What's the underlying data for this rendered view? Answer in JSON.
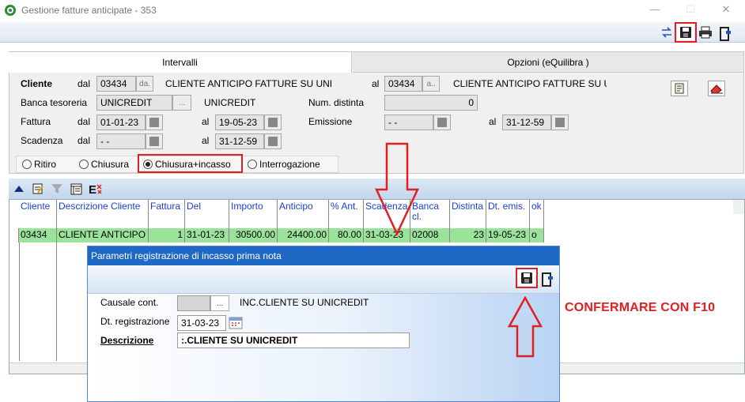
{
  "window": {
    "title": "Gestione fatture anticipate - 353",
    "minimize_glyph": "—",
    "maximize_glyph": "☐",
    "close_glyph": "✕"
  },
  "toolbar": {
    "icons": [
      "swap-arrows-icon",
      "save-icon",
      "print-icon",
      "exit-icon"
    ]
  },
  "tabs": [
    {
      "label": "Intervalli",
      "active": true
    },
    {
      "label": "Opzioni (eQuilibra )",
      "active": false
    }
  ],
  "filters": {
    "cliente": {
      "label": "Cliente",
      "dal_label": "dal",
      "al_label": "al",
      "from_code": "03434",
      "from_btn": "da.",
      "from_name": "CLIENTE ANTICIPO FATTURE SU UNI",
      "to_code": "03434",
      "to_btn": "a..",
      "to_name": "CLIENTE ANTICIPO FATTURE SU U"
    },
    "banca": {
      "label": "Banca tesoreria",
      "code": "UNICREDIT",
      "btn": "...",
      "name": "UNICREDIT",
      "num_distinta_label": "Num. distinta",
      "num_distinta": "0"
    },
    "fattura": {
      "label": "Fattura",
      "dal_label": "dal",
      "al_label": "al",
      "from": "01-01-23",
      "to": "19-05-23"
    },
    "emissione": {
      "label": "Emissione",
      "al_label": "al",
      "from": "- -",
      "to": "31-12-59"
    },
    "scadenza": {
      "label": "Scadenza",
      "dal_label": "dal",
      "al_label": "al",
      "from": "- -",
      "to": "31-12-59"
    }
  },
  "radio_options": [
    {
      "label": "Ritiro",
      "selected": false
    },
    {
      "label": "Chiusura",
      "selected": false
    },
    {
      "label": "Chiusura+incasso",
      "selected": true
    },
    {
      "label": "Interrogazione",
      "selected": false
    }
  ],
  "grid": {
    "columns": [
      "Cliente",
      "Descrizione Cliente",
      "Fattura",
      "Del",
      "Importo",
      "Anticipo",
      "% Ant.",
      "Scadenza",
      "Banca cl.",
      "Distinta",
      "Dt. emis.",
      "ok"
    ],
    "rows": [
      {
        "cliente": "03434",
        "descrizione": "CLIENTE ANTICIPO I",
        "fattura": "1",
        "del": "31-01-23",
        "importo": "30500.00",
        "anticipo": "24400.00",
        "perc_ant": "80.00",
        "scadenza": "31-03-23",
        "banca": "02008",
        "distinta": "23",
        "dt_emis": "19-05-23",
        "ok": "o"
      }
    ]
  },
  "dialog": {
    "title": "Parametri registrazione di incasso prima nota",
    "causale_label": "Causale cont.",
    "causale_code": "",
    "causale_btn": "...",
    "causale_name": "INC.CLIENTE SU UNICREDIT",
    "dt_label": "Dt. registrazione",
    "dt_value": "31-03-23",
    "desc_label": "Descrizione",
    "desc_value": ":.CLIENTE SU UNICREDIT"
  },
  "annotation": {
    "text": "CONFERMARE CON F10",
    "color": "#e02020"
  }
}
